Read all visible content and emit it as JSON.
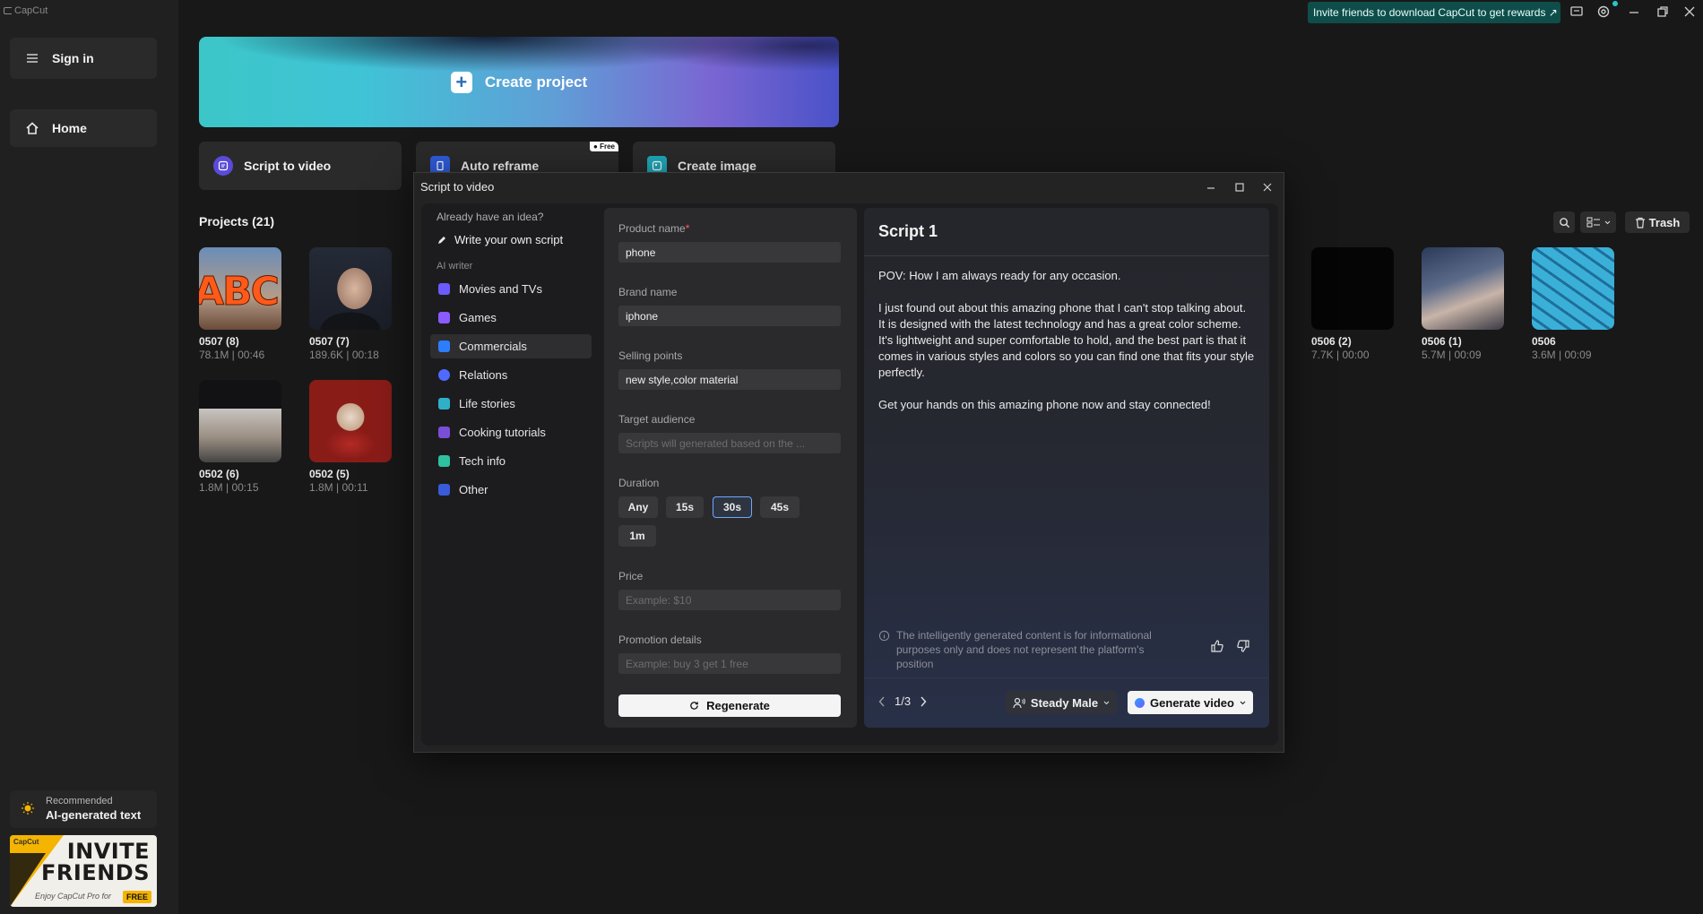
{
  "app": {
    "logo": "CapCut"
  },
  "sidebar": {
    "sign_in": "Sign in",
    "home": "Home",
    "recommended_label": "Recommended",
    "recommended_title": "AI-generated text",
    "banner_brand": "CapCut",
    "banner_line1": "INVITE",
    "banner_line2": "FRIENDS",
    "banner_sub": "Enjoy CapCut Pro for",
    "banner_free": "FREE"
  },
  "topbar": {
    "invite": "Invite friends to download CapCut to get rewards ↗"
  },
  "main": {
    "create_project": "Create project",
    "tiles": [
      {
        "label": "Script to video",
        "icon": "script-icon"
      },
      {
        "label": "Auto reframe",
        "icon": "reframe-icon",
        "badge": "Free"
      },
      {
        "label": "Create image",
        "icon": "image-icon"
      }
    ],
    "projects_title": "Projects  (21)",
    "trash": "Trash",
    "projects": [
      {
        "name": "0507 (8)",
        "meta": "78.1M | 00:46"
      },
      {
        "name": "0507 (7)",
        "meta": "189.6K | 00:18"
      },
      {
        "name": "0502 (6)",
        "meta": "1.8M | 00:15"
      },
      {
        "name": "0502 (5)",
        "meta": "1.8M | 00:11"
      },
      {
        "name": "0506 (2)",
        "meta": "7.7K | 00:00"
      },
      {
        "name": "0506 (1)",
        "meta": "5.7M | 00:09"
      },
      {
        "name": "0506",
        "meta": "3.6M | 00:09"
      }
    ],
    "thumb_text_abc": "ABC"
  },
  "dialog": {
    "title": "Script to video",
    "nav": {
      "already": "Already have an idea?",
      "write_own": "Write your own script",
      "ai_writer": "AI writer",
      "items": [
        {
          "label": "Movies and TVs",
          "color": "#6b5bff"
        },
        {
          "label": "Games",
          "color": "#8a5bff"
        },
        {
          "label": "Commercials",
          "color": "#2f7dff"
        },
        {
          "label": "Relations",
          "color": "#4f6bff"
        },
        {
          "label": "Life stories",
          "color": "#2fb0c8"
        },
        {
          "label": "Cooking tutorials",
          "color": "#7a4fd8"
        },
        {
          "label": "Tech info",
          "color": "#2fc0a0"
        },
        {
          "label": "Other",
          "color": "#3a5bd8"
        }
      ]
    },
    "form": {
      "product_name_label": "Product name",
      "required_mark": "*",
      "product_name": "phone",
      "brand_name_label": "Brand name",
      "brand_name": "iphone",
      "selling_points_label": "Selling points",
      "selling_points": "new style,color material",
      "target_audience_label": "Target audience",
      "target_audience_placeholder": "Scripts will generated based on the ...",
      "duration_label": "Duration",
      "durations": [
        "Any",
        "15s",
        "30s",
        "45s",
        "1m"
      ],
      "duration_selected": "30s",
      "price_label": "Price",
      "price_placeholder": "Example: $10",
      "promotion_label": "Promotion details",
      "promotion_placeholder": "Example: buy 3 get 1 free",
      "regenerate": "Regenerate"
    },
    "script": {
      "title": "Script 1",
      "text": "POV: How I am always ready for any occasion.\n\nI just found out about this amazing phone that I can't stop talking about. It is designed with the latest technology and has a great color scheme. It's lightweight and super comfortable to hold, and the best part is that it comes in various styles and colors so you can find one that fits your style perfectly.\n\nGet your hands on this amazing phone now and stay connected!",
      "disclaimer": "The intelligently generated content is for informational purposes only and does not represent the platform's position",
      "pager": "1/3",
      "voice": "Steady Male",
      "generate": "Generate video"
    }
  }
}
